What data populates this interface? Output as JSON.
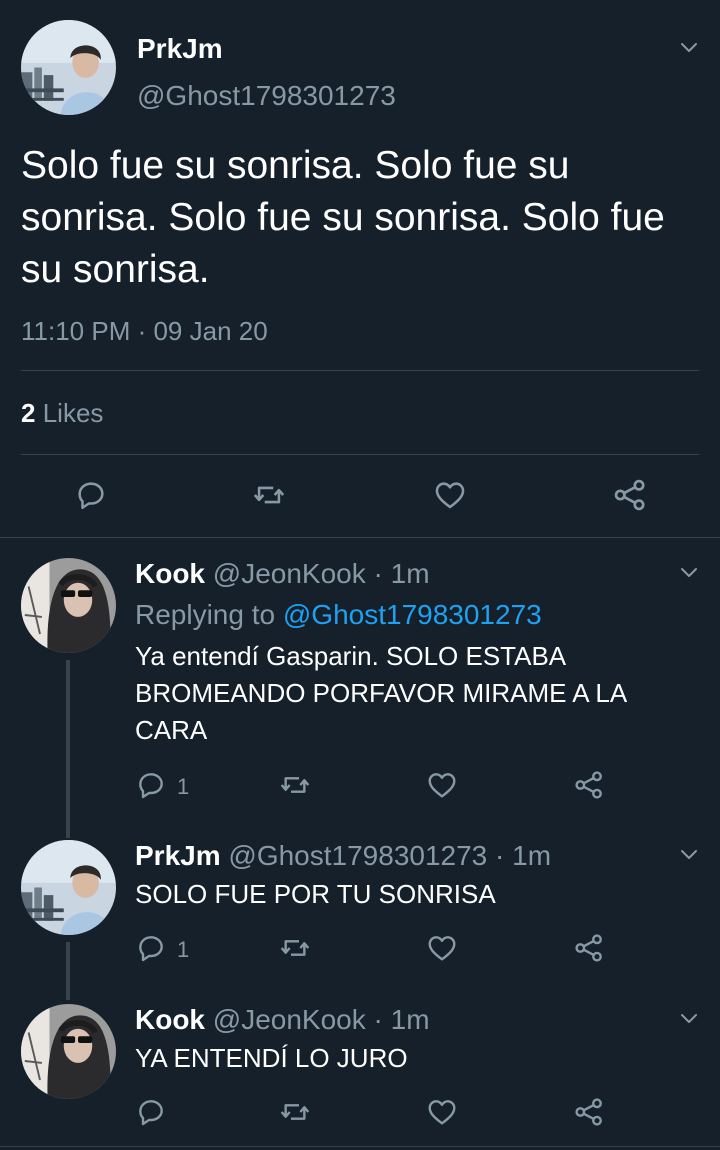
{
  "main_tweet": {
    "display_name": "PrkJm",
    "handle": "@Ghost1798301273",
    "text": "Solo fue su sonrisa. Solo fue su sonrisa. Solo fue su sonrisa. Solo fue su sonrisa.",
    "timestamp": "11:10 PM · 09 Jan 20",
    "likes_count": "2",
    "likes_label": "Likes"
  },
  "replies": [
    {
      "display_name": "Kook",
      "handle": "@JeonKook",
      "time": "· 1m",
      "replying_prefix": "Replying to",
      "replying_to": "@Ghost1798301273",
      "text": "Ya entendí Gasparin. SOLO ESTABA BROMEANDO PORFAVOR MIRAME A LA CARA",
      "reply_count": "1"
    },
    {
      "display_name": "PrkJm",
      "handle": "@Ghost1798301273",
      "time": "· 1m",
      "text": "SOLO FUE POR TU SONRISA",
      "reply_count": "1"
    },
    {
      "display_name": "Kook",
      "handle": "@JeonKook",
      "time": "· 1m",
      "text": "YA ENTENDÍ LO JURO"
    }
  ],
  "icons": [
    "chevron-down-icon",
    "reply-icon",
    "retweet-icon",
    "like-icon",
    "share-icon"
  ],
  "colors": {
    "background": "#15202b",
    "muted": "#8899a6",
    "link": "#1da1f2",
    "divider": "#38444d"
  }
}
